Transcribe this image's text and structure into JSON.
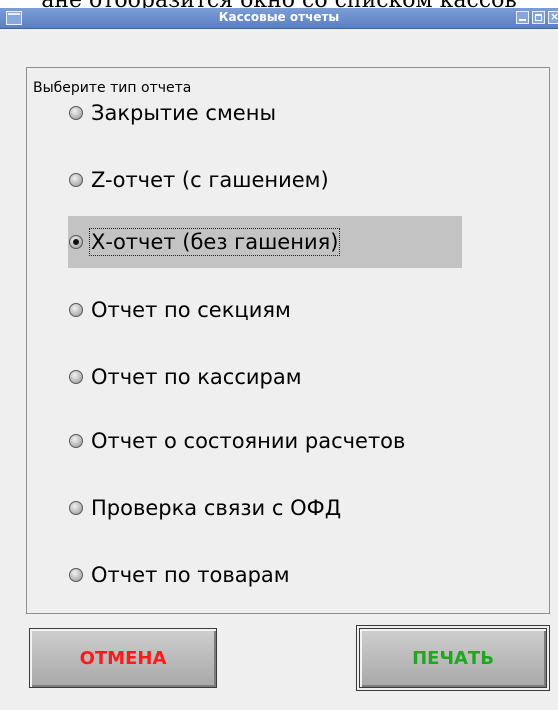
{
  "background_text": "ане отобразится окно со списком кассов",
  "window": {
    "title": "Кассовые отчеты"
  },
  "group": {
    "legend": "Выберите тип отчета"
  },
  "report_types": [
    {
      "label": "Закрытие смены",
      "selected": false
    },
    {
      "label": "Z-отчет (с гашением)",
      "selected": false
    },
    {
      "label": "Х-отчет (без гашения)",
      "selected": true
    },
    {
      "label": "Отчет по секциям",
      "selected": false
    },
    {
      "label": "Отчет по кассирам",
      "selected": false
    },
    {
      "label": "Отчет о состоянии расчетов",
      "selected": false
    },
    {
      "label": "Проверка связи с ОФД",
      "selected": false
    },
    {
      "label": "Отчет по товарам",
      "selected": false
    }
  ],
  "buttons": {
    "cancel_label": "ОТМЕНА",
    "print_label": "ПЕЧАТЬ"
  },
  "colors": {
    "titlebar": "#5a7fc4",
    "cancel_text": "#ff1a1a",
    "print_text": "#1fa81f",
    "selected_item_bg": "#c3c3c3"
  }
}
